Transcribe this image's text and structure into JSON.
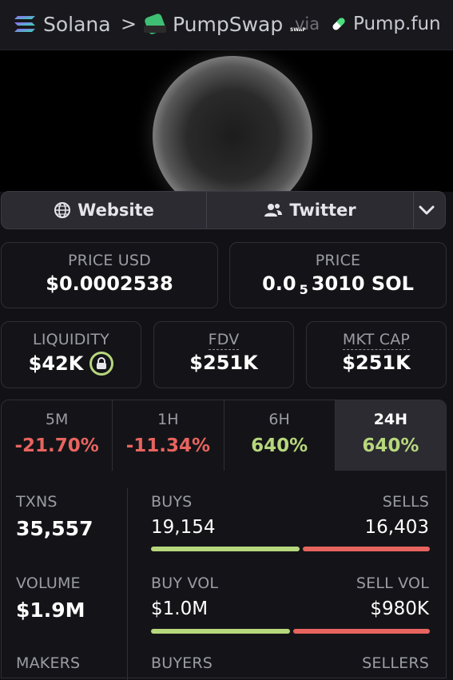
{
  "breadcrumb": {
    "chain": "Solana",
    "separator": ">",
    "dex": "PumpSwap",
    "dex_icon_text": "SWAP",
    "via": "via",
    "launchpad": "Pump.fun"
  },
  "links": {
    "website": "Website",
    "twitter": "Twitter"
  },
  "price_usd": {
    "label": "PRICE USD",
    "value": "$0.0002538"
  },
  "price_native": {
    "label": "PRICE",
    "prefix": "0.0",
    "zeros": "5",
    "digits": "3010",
    "unit": "SOL"
  },
  "metrics": {
    "liquidity": {
      "label": "LIQUIDITY",
      "value": "$42K"
    },
    "fdv": {
      "label": "FDV",
      "value": "$251K"
    },
    "mkt_cap": {
      "label": "MKT CAP",
      "value": "$251K"
    }
  },
  "periods": [
    {
      "label": "5M",
      "change": "-21.70%",
      "color": "#e8645f",
      "active": false
    },
    {
      "label": "1H",
      "change": "-11.34%",
      "color": "#e8645f",
      "active": false
    },
    {
      "label": "6H",
      "change": "640%",
      "color": "#b7d77d",
      "active": false
    },
    {
      "label": "24H",
      "change": "640%",
      "color": "#b7d77d",
      "active": true
    }
  ],
  "stats": {
    "txns": {
      "label": "TXNS",
      "value": "35,557"
    },
    "volume": {
      "label": "VOLUME",
      "value": "$1.9M"
    },
    "makers": {
      "label": "MAKERS"
    },
    "buys": {
      "label": "BUYS",
      "value": "19,154"
    },
    "sells": {
      "label": "SELLS",
      "value": "16,403"
    },
    "buy_vol": {
      "label": "BUY VOL",
      "value": "$1.0M"
    },
    "sell_vol": {
      "label": "SELL VOL",
      "value": "$980K"
    },
    "buyers": {
      "label": "BUYERS"
    },
    "sellers": {
      "label": "SELLERS"
    },
    "buy_fraction_txns": 0.539,
    "buy_fraction_vol": 0.505
  },
  "colors": {
    "positive": "#b7d77d",
    "negative": "#e8645f",
    "accent_green": "#3fbf73"
  }
}
